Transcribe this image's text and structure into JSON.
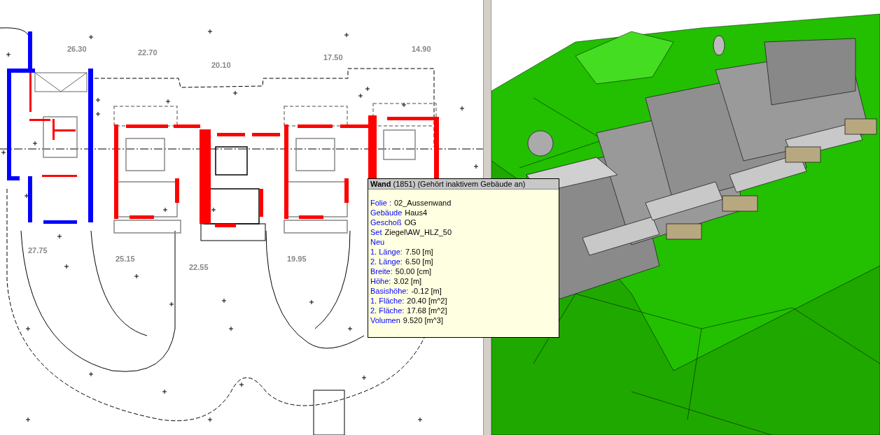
{
  "plan_view": {
    "spot_heights": [
      "26.30",
      "22.70",
      "20.10",
      "17.50",
      "14.90",
      "27.75",
      "25.15",
      "22.55",
      "19.95"
    ]
  },
  "tooltip": {
    "title": "**Wand** (1851) (Gehört inaktivem Gebäude an)",
    "rows": [
      {
        "kind": "pair",
        "label": "Folie :",
        "value": "02_Aussenwand"
      },
      {
        "kind": "pair",
        "label": "Gebäude",
        "value": "Haus4"
      },
      {
        "kind": "pair",
        "label": "Geschoß",
        "value": "OG"
      },
      {
        "kind": "pair",
        "label": "Set",
        "value": "Ziegel\\AW_HLZ_50"
      },
      {
        "kind": "flag",
        "label": "Neu"
      },
      {
        "kind": "pair",
        "label": "1. Länge:",
        "value": "7.50 [m]"
      },
      {
        "kind": "pair",
        "label": "2. Länge:",
        "value": "6.50 [m]"
      },
      {
        "kind": "pair",
        "label": "Breite:",
        "value": "50.00 [cm]"
      },
      {
        "kind": "pair",
        "label": "Höhe:",
        "value": "3.02 [m]"
      },
      {
        "kind": "pair",
        "label": "Basishöhe:",
        "value": "-0.12 [m]"
      },
      {
        "kind": "pair",
        "label": "1. Fläche:",
        "value": "20.40 [m^2]"
      },
      {
        "kind": "pair",
        "label": "2. Fläche:",
        "value": "17.68 [m^2]"
      },
      {
        "kind": "pair",
        "label": "Volumen",
        "value": "9.520 [m^3]"
      }
    ]
  }
}
